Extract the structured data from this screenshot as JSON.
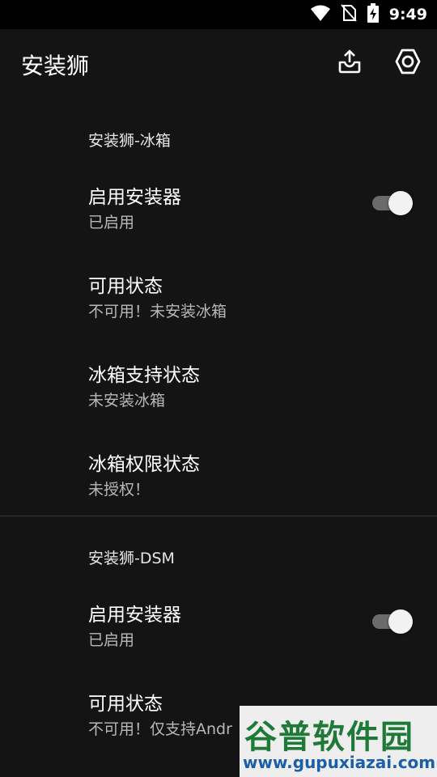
{
  "status_bar": {
    "time": "9:49",
    "icons": [
      "wifi-icon",
      "no-sim-icon",
      "battery-charging-icon"
    ]
  },
  "app_bar": {
    "title": "安装狮",
    "actions": [
      "share-upload-icon",
      "settings-icon"
    ]
  },
  "sections": [
    {
      "header": "安装狮-冰箱",
      "items": [
        {
          "title": "启用安装器",
          "summary": "已启用",
          "switch": true,
          "switch_on": true
        },
        {
          "title": "可用状态",
          "summary": "不可用！未安装冰箱"
        },
        {
          "title": "冰箱支持状态",
          "summary": "未安装冰箱"
        },
        {
          "title": "冰箱权限状态",
          "summary": "未授权！"
        }
      ]
    },
    {
      "header": "安装狮-DSM",
      "items": [
        {
          "title": "启用安装器",
          "summary": "已启用",
          "switch": true,
          "switch_on": true
        },
        {
          "title": "可用状态",
          "summary": "不可用！仅支持Andr"
        }
      ]
    }
  ],
  "watermark": {
    "name": "谷普软件园",
    "url": "www.gupuxiazai.com"
  }
}
